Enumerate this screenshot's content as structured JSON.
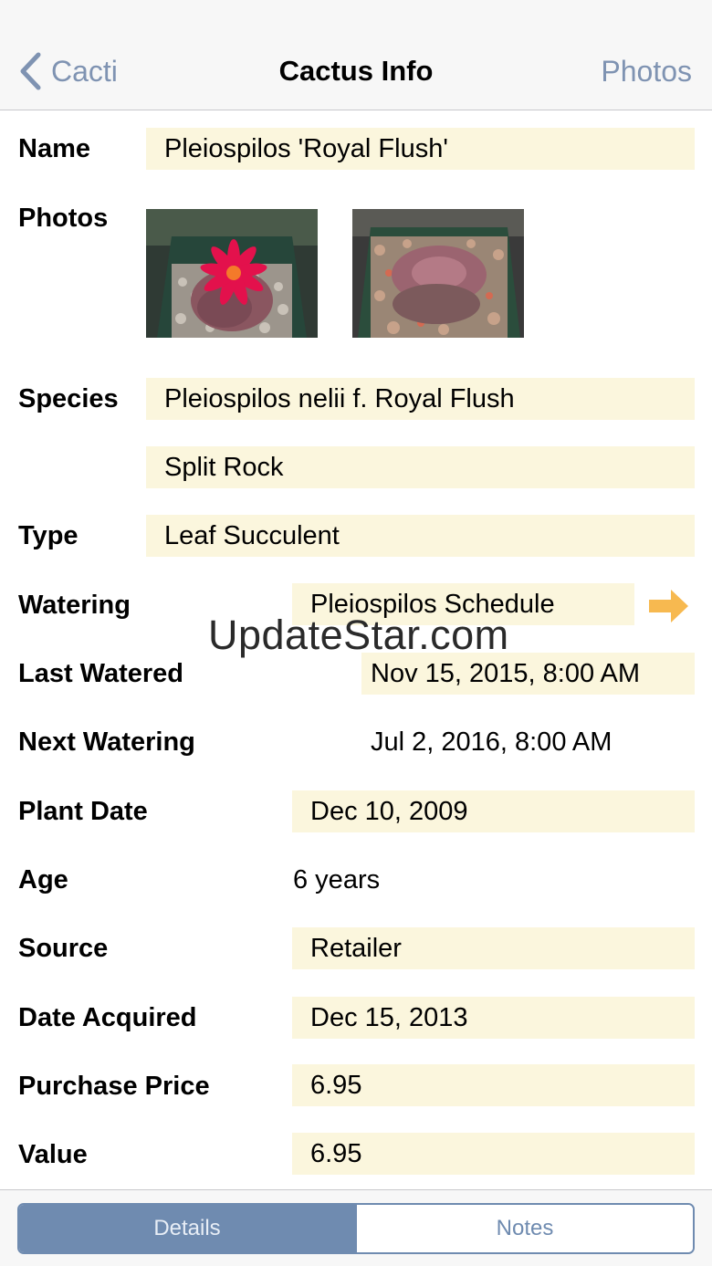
{
  "nav": {
    "back_label": "Cacti",
    "title": "Cactus Info",
    "right_label": "Photos"
  },
  "fields": {
    "name": {
      "label": "Name",
      "value": "Pleiospilos 'Royal Flush'"
    },
    "photos": {
      "label": "Photos"
    },
    "species": {
      "label": "Species",
      "value": "Pleiospilos nelii f. Royal Flush",
      "common_name": "Split Rock"
    },
    "type": {
      "label": "Type",
      "value": "Leaf Succulent"
    },
    "watering": {
      "label": "Watering",
      "value": "Pleiospilos Schedule"
    },
    "last_watered": {
      "label": "Last Watered",
      "value": "Nov 15, 2015, 8:00 AM"
    },
    "next_watering": {
      "label": "Next Watering",
      "value": "Jul 2, 2016, 8:00 AM"
    },
    "plant_date": {
      "label": "Plant Date",
      "value": "Dec 10, 2009"
    },
    "age": {
      "label": "Age",
      "value": "6 years"
    },
    "source": {
      "label": "Source",
      "value": "Retailer"
    },
    "date_acquired": {
      "label": "Date Acquired",
      "value": "Dec 15, 2013"
    },
    "purchase_price": {
      "label": "Purchase Price",
      "value": "6.95"
    },
    "value": {
      "label": "Value",
      "value": "6.95"
    }
  },
  "watermark": "UpdateStar.com",
  "tabs": {
    "details": "Details",
    "notes": "Notes",
    "selected": "Details"
  },
  "colors": {
    "accent": "#7f93b2",
    "field_bg": "#fbf6dd",
    "arrow": "#f7b950",
    "segment": "#6f8bb0"
  }
}
